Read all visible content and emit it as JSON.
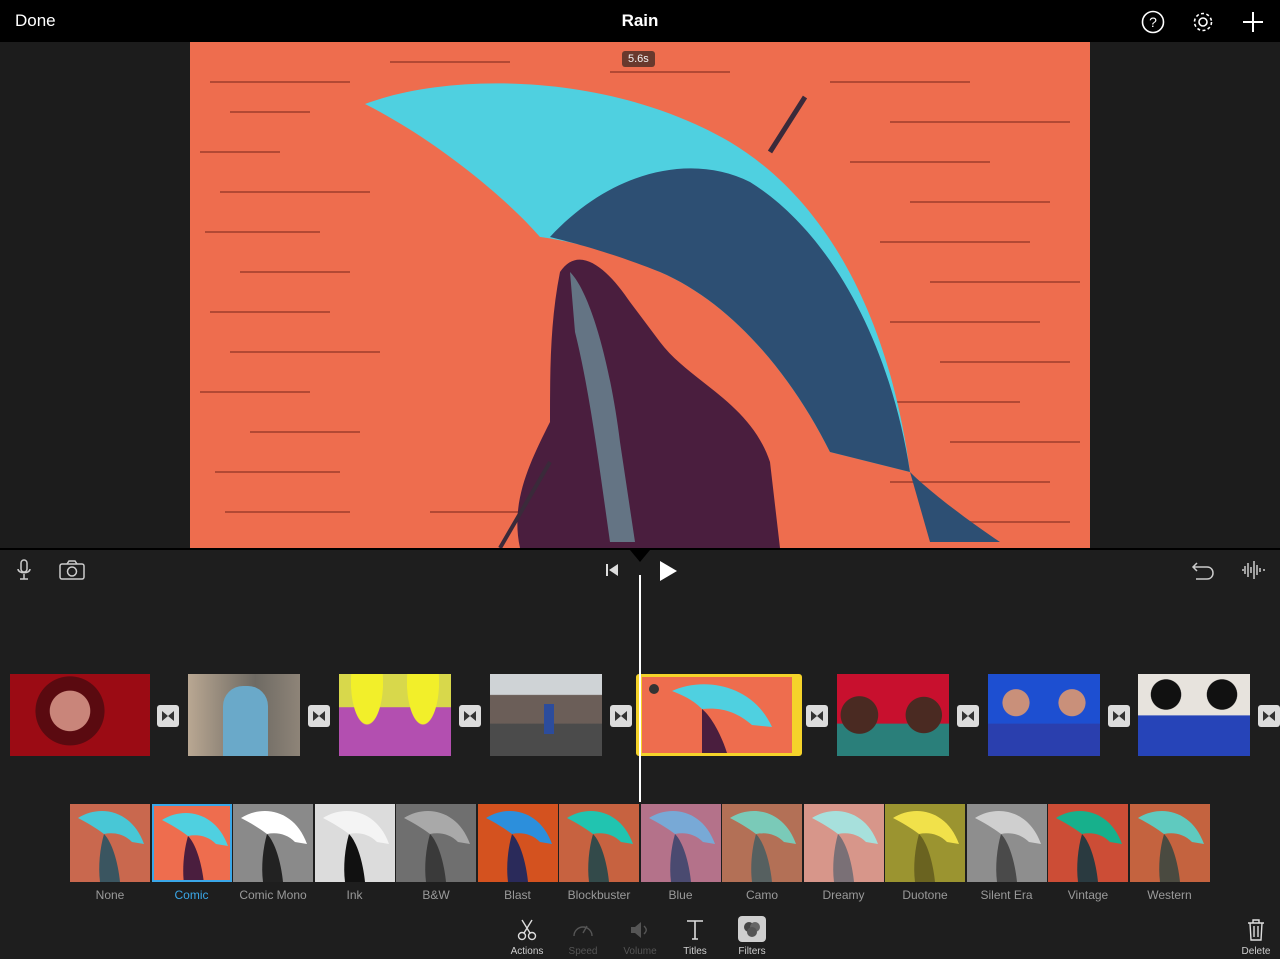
{
  "header": {
    "done_label": "Done",
    "title": "Rain"
  },
  "viewer": {
    "duration": "5.6s"
  },
  "filters": {
    "items": [
      {
        "label": "None"
      },
      {
        "label": "Comic"
      },
      {
        "label": "Comic Mono"
      },
      {
        "label": "Ink"
      },
      {
        "label": "B&W"
      },
      {
        "label": "Blast"
      },
      {
        "label": "Blockbuster"
      },
      {
        "label": "Blue"
      },
      {
        "label": "Camo"
      },
      {
        "label": "Dreamy"
      },
      {
        "label": "Duotone"
      },
      {
        "label": "Silent Era"
      },
      {
        "label": "Vintage"
      },
      {
        "label": "Western"
      }
    ],
    "selected": "Comic"
  },
  "toolbar": {
    "actions": "Actions",
    "speed": "Speed",
    "volume": "Volume",
    "titles": "Titles",
    "filters": "Filters",
    "delete": "Delete"
  },
  "colors": {
    "accent": "#3aa7e8",
    "selected_clip": "#f5d32a",
    "preview_bg": "#ee6d4e",
    "umbrella": "#4fd0e0"
  },
  "icons": [
    "help-icon",
    "gear-icon",
    "plus-icon",
    "microphone-icon",
    "camera-icon",
    "skip-to-start-icon",
    "play-icon",
    "undo-icon",
    "waveform-icon",
    "scissors-icon",
    "speedometer-icon",
    "speaker-icon",
    "text-t-icon",
    "filters-icon",
    "trash-icon",
    "transition-icon"
  ]
}
